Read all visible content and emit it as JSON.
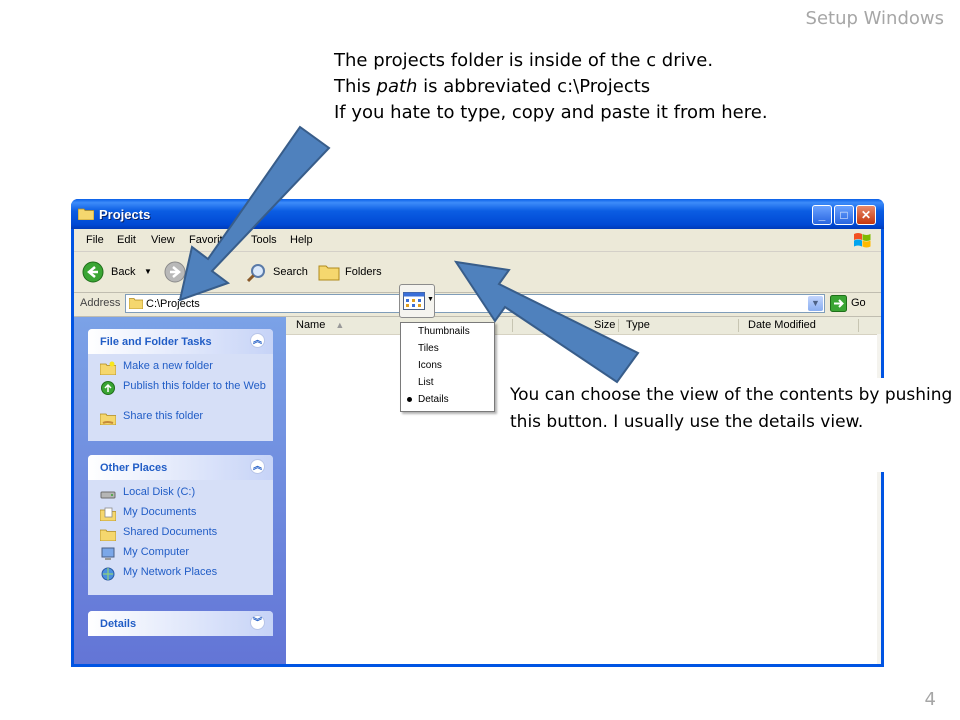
{
  "slide": {
    "title": "Setup Windows",
    "page_number": "4",
    "top_note": {
      "line1": "The projects folder is inside of the c drive.",
      "line2_a": "This ",
      "line2_em": "path",
      "line2_b": " is abbreviated c:\\Projects",
      "line3": "If you hate to type, copy and paste it from here."
    },
    "right_note": "You can choose the view of the contents by pushing this button.  I usually use the details view."
  },
  "window": {
    "title": "Projects",
    "menu": [
      "File",
      "Edit",
      "View",
      "Favorites",
      "Tools",
      "Help"
    ],
    "toolbar": {
      "back": "Back",
      "search": "Search",
      "folders": "Folders"
    },
    "address": {
      "label": "Address",
      "value": "C:\\Projects",
      "go": "Go"
    },
    "views_menu": {
      "items": [
        "Thumbnails",
        "Tiles",
        "Icons",
        "List",
        "Details"
      ],
      "selected": "Details"
    },
    "columns": [
      "Name",
      "Size",
      "Type",
      "Date Modified"
    ],
    "tasks_panel": {
      "title": "File and Folder Tasks",
      "items": [
        "Make a new folder",
        "Publish this folder to the Web",
        "Share this folder"
      ]
    },
    "places_panel": {
      "title": "Other Places",
      "items": [
        "Local Disk (C:)",
        "My Documents",
        "Shared Documents",
        "My Computer",
        "My Network Places"
      ]
    },
    "details_panel": {
      "title": "Details"
    }
  },
  "colors": {
    "titlebar": "#0054e3",
    "task_link": "#215dc6",
    "arrow_fill": "#4f81bd",
    "arrow_stroke": "#385d8a"
  }
}
